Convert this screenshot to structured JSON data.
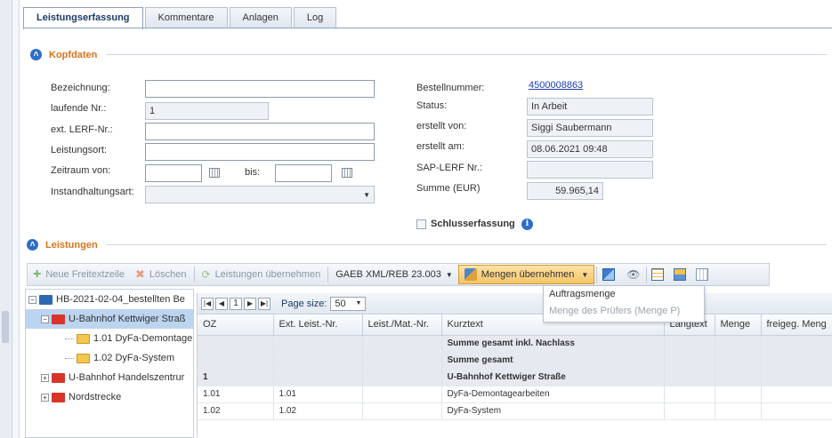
{
  "tabs": [
    "Leistungserfassung",
    "Kommentare",
    "Anlagen",
    "Log"
  ],
  "kopfdaten": {
    "title": "Kopfdaten",
    "labels": {
      "bezeichnung": "Bezeichnung:",
      "laufende_nr": "laufende Nr.:",
      "ext_lerf": "ext. LERF-Nr.:",
      "leistungsort": "Leistungsort:",
      "zeitraum_von": "Zeitraum von:",
      "bis": "bis:",
      "instandhaltungsart": "Instandhaltungsart:",
      "bestellnummer": "Bestellnummer:",
      "status": "Status:",
      "erstellt_von": "erstellt von:",
      "erstellt_am": "erstellt am:",
      "sap_lerf": "SAP-LERF Nr.:",
      "summe": "Summe (EUR)"
    },
    "values": {
      "bezeichnung": "",
      "laufende_nr": "1",
      "ext_lerf": "",
      "leistungsort": "",
      "zeitraum_von": "",
      "bis": "",
      "instandhaltungsart": "",
      "bestellnummer": "4500008863",
      "status": "In Arbeit",
      "erstellt_von": "Siggi Saubermann",
      "erstellt_am": "08.06.2021 09:48",
      "sap_lerf": "",
      "summe": "59.965,14"
    },
    "schlusserfassung": "Schlusserfassung"
  },
  "leistungen": {
    "title": "Leistungen",
    "toolbar": {
      "neue_freitextzeile": "Neue Freitextzeile",
      "loeschen": "Löschen",
      "leistungen_uebernehmen": "Leistungen übernehmen",
      "gaeb": "GAEB XML/REB 23.003",
      "mengen_uebernehmen": "Mengen übernehmen"
    },
    "dropdown": [
      "Auftragsmenge",
      "Menge des Prüfers (Menge P)"
    ],
    "tree": [
      "HB-2021-02-04_bestellten Be",
      "U-Bahnhof Kettwiger Straß",
      "1.01 DyFa-Demontage",
      "1.02 DyFa-System",
      "U-Bahnhof Handelszentrur",
      "Nordstrecke"
    ],
    "pager": {
      "page": "1",
      "page_size_label": "Page size:",
      "page_size": "50"
    },
    "columns": [
      "OZ",
      "Ext. Leist.-Nr.",
      "Leist./Mat.-Nr.",
      "Kurztext",
      "Langtext",
      "Menge",
      "freigeg. Meng"
    ],
    "rows": [
      {
        "oz": "",
        "ext": "",
        "mat": "",
        "kurz": "Summe gesamt inkl. Nachlass"
      },
      {
        "oz": "",
        "ext": "",
        "mat": "",
        "kurz": "Summe gesamt"
      },
      {
        "oz": "1",
        "ext": "",
        "mat": "",
        "kurz": "U-Bahnhof Kettwiger Straße"
      },
      {
        "oz": "1.01",
        "ext": "1.01",
        "mat": "",
        "kurz": "DyFa-Demontagearbeiten"
      },
      {
        "oz": "1.02",
        "ext": "1.02",
        "mat": "",
        "kurz": "DyFa-System"
      }
    ]
  }
}
